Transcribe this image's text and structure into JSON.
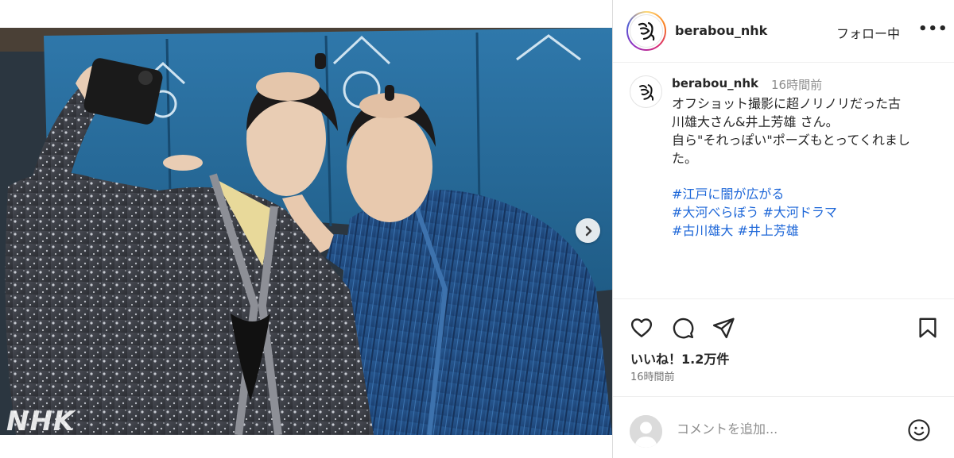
{
  "post": {
    "watermark": "NHK",
    "carousel_total": 6,
    "carousel_active": 1
  },
  "header": {
    "username": "berabou_nhk",
    "follow_label": "フォロー中",
    "more_label": "•••"
  },
  "caption": {
    "username": "berabou_nhk",
    "time": "16時間前",
    "lines": [
      "オフショット撮影に超ノリノリだった古",
      "川雄大さん&井上芳雄 さん。",
      "自ら\"それっぽい\"ポーズもとってくれまし",
      "た。"
    ],
    "hashtag_lines": [
      [
        "#江戸に闇が広がる"
      ],
      [
        "#大河べらぼう",
        "#大河ドラマ"
      ],
      [
        "#古川雄大",
        "#井上芳雄"
      ]
    ]
  },
  "actions": {
    "icons": [
      "heart-icon",
      "comment-icon",
      "share-icon",
      "bookmark-icon"
    ],
    "likes": "いいね！1.2万件",
    "timestamp": "16時間前"
  },
  "comment": {
    "placeholder": "コメントを追加...",
    "emoji_icon": "smiley-icon"
  },
  "colors": {
    "link": "#1e67d8",
    "text": "#262626",
    "muted": "#8e8e8e",
    "curtain": "#2a6fa2"
  }
}
